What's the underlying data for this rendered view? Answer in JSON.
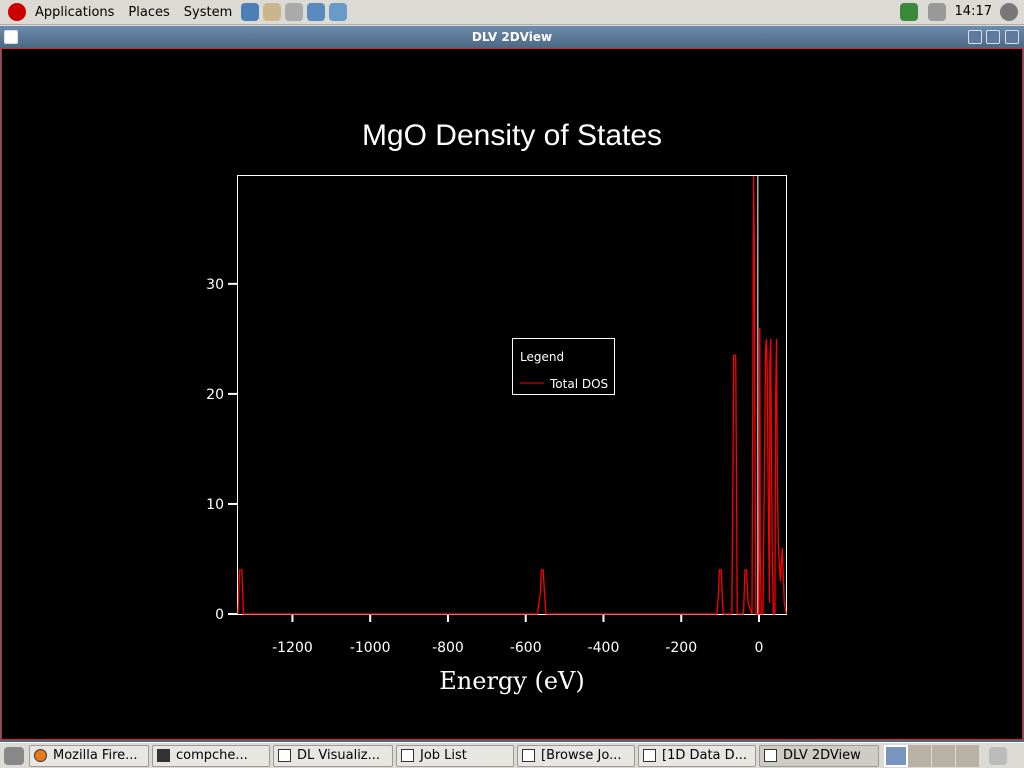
{
  "top_panel": {
    "menus": [
      "Applications",
      "Places",
      "System"
    ],
    "clock": "14:17"
  },
  "window": {
    "title": "DLV 2DView"
  },
  "taskbar": {
    "tasks": [
      "Mozilla Fire...",
      "compche...",
      "DL Visualiz...",
      "Job List",
      "[Browse Jo...",
      "[1D Data D...",
      "DLV 2DView"
    ]
  },
  "chart_data": {
    "type": "line",
    "title": "MgO Density of States",
    "xlabel": "Energy (eV)",
    "ylabel": "",
    "xlim": [
      -1340,
      72
    ],
    "ylim": [
      0,
      39.8
    ],
    "xticks": [
      -1200,
      -1000,
      -800,
      -600,
      -400,
      -200,
      0
    ],
    "yticks": [
      0,
      10,
      20,
      30
    ],
    "legend": {
      "title": "Legend",
      "placement": "center",
      "entries": [
        "Total DOS"
      ]
    },
    "series": [
      {
        "name": "Total DOS",
        "color": "#ff0000",
        "points": [
          [
            -1340,
            0
          ],
          [
            -1336,
            4
          ],
          [
            -1330,
            4
          ],
          [
            -1326,
            0
          ],
          [
            -570,
            0
          ],
          [
            -562,
            2
          ],
          [
            -560,
            4
          ],
          [
            -555,
            4
          ],
          [
            -552,
            2
          ],
          [
            -548,
            0
          ],
          [
            -108,
            0
          ],
          [
            -104,
            2
          ],
          [
            -102,
            4
          ],
          [
            -97,
            4
          ],
          [
            -95,
            2
          ],
          [
            -92,
            0
          ],
          [
            -70,
            0
          ],
          [
            -68,
            8
          ],
          [
            -65,
            23.5
          ],
          [
            -60,
            23.5
          ],
          [
            -58,
            12
          ],
          [
            -56,
            0
          ],
          [
            -40,
            0
          ],
          [
            -36,
            4
          ],
          [
            -32,
            4
          ],
          [
            -28,
            1
          ],
          [
            -18,
            0
          ],
          [
            -16,
            20
          ],
          [
            -14,
            39.8
          ],
          [
            -12,
            34
          ],
          [
            -11,
            20
          ],
          [
            -8,
            0
          ],
          [
            0,
            0
          ],
          [
            2,
            26
          ],
          [
            3,
            6
          ],
          [
            6,
            0
          ],
          [
            10,
            0
          ],
          [
            14,
            13
          ],
          [
            17,
            24
          ],
          [
            19,
            25
          ],
          [
            21,
            22
          ],
          [
            24,
            10
          ],
          [
            27,
            1
          ],
          [
            28,
            23
          ],
          [
            30,
            25
          ],
          [
            32,
            16
          ],
          [
            34,
            6
          ],
          [
            37,
            0
          ],
          [
            41,
            0
          ],
          [
            43,
            20
          ],
          [
            45,
            25
          ],
          [
            47,
            13
          ],
          [
            50,
            6
          ],
          [
            55,
            3
          ],
          [
            60,
            6
          ],
          [
            65,
            1
          ],
          [
            70,
            0
          ]
        ]
      }
    ]
  }
}
